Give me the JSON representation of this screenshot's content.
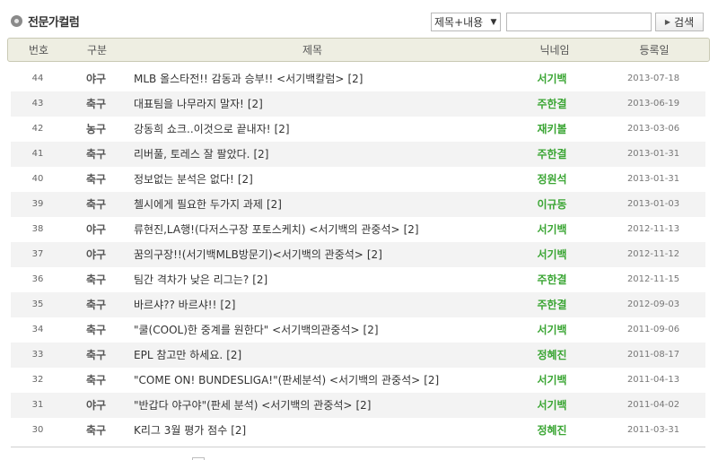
{
  "header": {
    "title": "전문가컬럼",
    "search_select_value": "제목+내용",
    "search_placeholder": "",
    "search_button_label": "검색"
  },
  "columns": {
    "num": "번호",
    "category": "구분",
    "subject": "제목",
    "nickname": "닉네임",
    "date": "등록일"
  },
  "rows": [
    {
      "num": "44",
      "category": "야구",
      "subject": "MLB 올스타전!! 감동과 승부!! <서기백칼럼>",
      "comments": "[2]",
      "nickname": "서기백",
      "date": "2013-07-18"
    },
    {
      "num": "43",
      "category": "축구",
      "subject": "대표팀을 나무라지 말자!",
      "comments": "[2]",
      "nickname": "주한결",
      "date": "2013-06-19"
    },
    {
      "num": "42",
      "category": "농구",
      "subject": "강동희 쇼크..이것으로 끝내자!",
      "comments": "[2]",
      "nickname": "재키볼",
      "date": "2013-03-06"
    },
    {
      "num": "41",
      "category": "축구",
      "subject": "리버풀, 토레스 잘 팔았다.",
      "comments": "[2]",
      "nickname": "주한결",
      "date": "2013-01-31"
    },
    {
      "num": "40",
      "category": "축구",
      "subject": "정보없는 분석은 없다!",
      "comments": "[2]",
      "nickname": "정원석",
      "date": "2013-01-31"
    },
    {
      "num": "39",
      "category": "축구",
      "subject": "첼시에게 필요한 두가지 과제",
      "comments": "[2]",
      "nickname": "이규동",
      "date": "2013-01-03"
    },
    {
      "num": "38",
      "category": "야구",
      "subject": "류현진,LA행!(다저스구장 포토스케치) <서기백의 관중석>",
      "comments": "[2]",
      "nickname": "서기백",
      "date": "2012-11-13"
    },
    {
      "num": "37",
      "category": "야구",
      "subject": "꿈의구장!!(서기백MLB방문기)<서기백의 관중석>",
      "comments": "[2]",
      "nickname": "서기백",
      "date": "2012-11-12"
    },
    {
      "num": "36",
      "category": "축구",
      "subject": "팀간 격차가 낮은 리그는?",
      "comments": "[2]",
      "nickname": "주한결",
      "date": "2012-11-15"
    },
    {
      "num": "35",
      "category": "축구",
      "subject": "바르샤?? 바르샤!!",
      "comments": "[2]",
      "nickname": "주한결",
      "date": "2012-09-03"
    },
    {
      "num": "34",
      "category": "축구",
      "subject": "\"쿨(COOL)한 중계를 원한다\" <서기백의관중석>",
      "comments": "[2]",
      "nickname": "서기백",
      "date": "2011-09-06"
    },
    {
      "num": "33",
      "category": "축구",
      "subject": "EPL 참고만 하세요.",
      "comments": "[2]",
      "nickname": "정혜진",
      "date": "2011-08-17"
    },
    {
      "num": "32",
      "category": "축구",
      "subject": "\"COME ON! BUNDESLIGA!\"(판세분석) <서기백의 관중석>",
      "comments": "[2]",
      "nickname": "서기백",
      "date": "2011-04-13"
    },
    {
      "num": "31",
      "category": "야구",
      "subject": "\"반갑다 야구야\"(판세 분석) <서기백의 관중석>",
      "comments": "[2]",
      "nickname": "서기백",
      "date": "2011-04-02"
    },
    {
      "num": "30",
      "category": "축구",
      "subject": "K리그 3월 평가 점수",
      "comments": "[2]",
      "nickname": "정혜진",
      "date": "2011-03-31"
    }
  ],
  "colors": {
    "nickname": "#3aa533",
    "header_bg": "#eeeee2",
    "row_alt": "#f3f3f3"
  }
}
